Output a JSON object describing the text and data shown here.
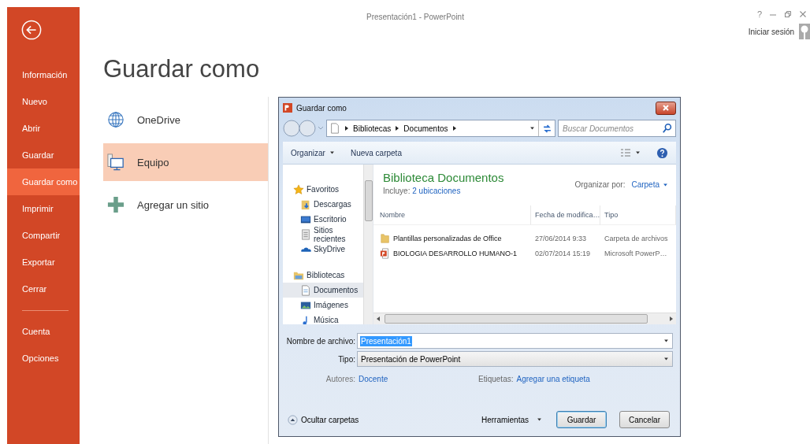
{
  "window": {
    "title": "Presentación1 - PowerPoint",
    "help": "?"
  },
  "account": {
    "sign_in": "Iniciar sesión"
  },
  "backstage": {
    "items": [
      {
        "label": "Información",
        "selected": false
      },
      {
        "label": "Nuevo",
        "selected": false
      },
      {
        "label": "Abrir",
        "selected": false
      },
      {
        "label": "Guardar",
        "selected": false
      },
      {
        "label": "Guardar como",
        "selected": true
      },
      {
        "label": "Imprimir",
        "selected": false
      },
      {
        "label": "Compartir",
        "selected": false
      },
      {
        "label": "Exportar",
        "selected": false
      },
      {
        "label": "Cerrar",
        "selected": false
      }
    ],
    "bottom_items": [
      {
        "label": "Cuenta",
        "selected": false
      },
      {
        "label": "Opciones",
        "selected": false
      }
    ]
  },
  "heading": "Guardar como",
  "places": [
    {
      "label": "OneDrive",
      "kind": "globe",
      "selected": false
    },
    {
      "label": "Equipo",
      "kind": "computer",
      "selected": true
    },
    {
      "label": "Agregar un sitio",
      "kind": "add",
      "selected": false
    }
  ],
  "dialog": {
    "title": "Guardar como",
    "breadcrumb": [
      "Bibliotecas",
      "Documentos"
    ],
    "search": {
      "placeholder": "Buscar Documentos"
    },
    "toolbar": {
      "organize": "Organizar",
      "new_folder": "Nueva carpeta"
    },
    "nav": [
      {
        "label": "Favoritos",
        "kind": "star",
        "selected": false,
        "children": [
          {
            "label": "Descargas",
            "kind": "downloads",
            "selected": false
          },
          {
            "label": "Escritorio",
            "kind": "desktop",
            "selected": false
          },
          {
            "label": "Sitios recientes",
            "kind": "recent",
            "selected": false
          },
          {
            "label": "SkyDrive",
            "kind": "cloud",
            "selected": false
          }
        ]
      },
      {
        "label": "Bibliotecas",
        "kind": "library",
        "selected": false,
        "children": [
          {
            "label": "Documentos",
            "kind": "documents",
            "selected": true
          },
          {
            "label": "Imágenes",
            "kind": "pictures",
            "selected": false
          },
          {
            "label": "Música",
            "kind": "music",
            "selected": false
          }
        ]
      }
    ],
    "library": {
      "title": "Biblioteca Documentos",
      "includes_label": "Incluye:",
      "includes_link": "2 ubicaciones",
      "arrange_label": "Organizar por:",
      "arrange_value": "Carpeta"
    },
    "columns": [
      "Nombre",
      "Fecha de modifica…",
      "Tipo"
    ],
    "rows": [
      {
        "kind": "folder",
        "name": "Plantillas personalizadas de Office",
        "date": "27/06/2014 9:33",
        "type": "Carpeta de archivos"
      },
      {
        "kind": "pptx",
        "name": "BIOLOGIA DESARROLLO HUMANO-1",
        "date": "02/07/2014 15:19",
        "type": "Microsoft PowerP…"
      }
    ],
    "filename": {
      "label": "Nombre de archivo:",
      "value": "Presentación1",
      "highlighted": true
    },
    "filetype": {
      "label": "Tipo:",
      "value": "Presentación de PowerPoint"
    },
    "authors": {
      "label": "Autores:",
      "value": "Docente"
    },
    "tags": {
      "label": "Etiquetas:",
      "value": "Agregar una etiqueta"
    },
    "hide_folders": "Ocultar carpetas",
    "tools": "Herramientas",
    "buttons": [
      {
        "label": "Guardar",
        "default": true
      },
      {
        "label": "Cancelar",
        "default": false
      }
    ]
  }
}
